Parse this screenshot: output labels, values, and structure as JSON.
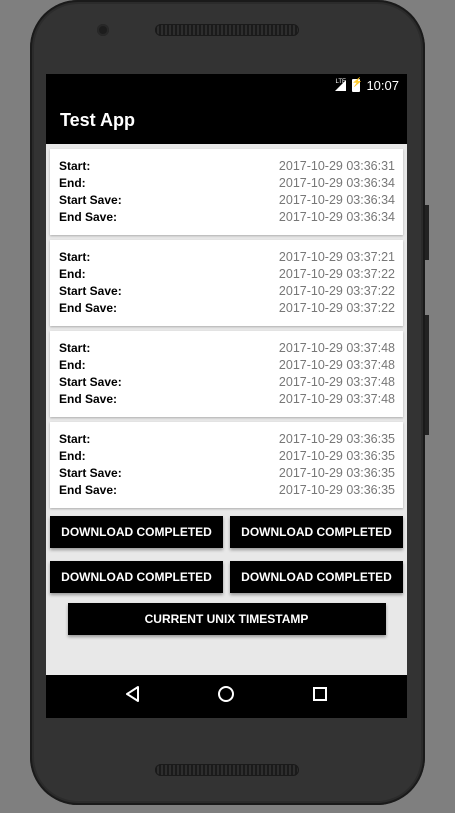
{
  "status_bar": {
    "network_label": "LTE",
    "time": "10:07"
  },
  "app": {
    "title": "Test App"
  },
  "cards": [
    {
      "rows": [
        {
          "label": "Start:",
          "value": "2017-10-29 03:36:31"
        },
        {
          "label": "End:",
          "value": "2017-10-29 03:36:34"
        },
        {
          "label": "Start Save:",
          "value": "2017-10-29 03:36:34"
        },
        {
          "label": "End Save:",
          "value": "2017-10-29 03:36:34"
        }
      ]
    },
    {
      "rows": [
        {
          "label": "Start:",
          "value": "2017-10-29 03:37:21"
        },
        {
          "label": "End:",
          "value": "2017-10-29 03:37:22"
        },
        {
          "label": "Start Save:",
          "value": "2017-10-29 03:37:22"
        },
        {
          "label": "End Save:",
          "value": "2017-10-29 03:37:22"
        }
      ]
    },
    {
      "rows": [
        {
          "label": "Start:",
          "value": "2017-10-29 03:37:48"
        },
        {
          "label": "End:",
          "value": "2017-10-29 03:37:48"
        },
        {
          "label": "Start Save:",
          "value": "2017-10-29 03:37:48"
        },
        {
          "label": "End Save:",
          "value": "2017-10-29 03:37:48"
        }
      ]
    },
    {
      "rows": [
        {
          "label": "Start:",
          "value": "2017-10-29 03:36:35"
        },
        {
          "label": "End:",
          "value": "2017-10-29 03:36:35"
        },
        {
          "label": "Start Save:",
          "value": "2017-10-29 03:36:35"
        },
        {
          "label": "End Save:",
          "value": "2017-10-29 03:36:35"
        }
      ]
    }
  ],
  "buttons": {
    "download": [
      "DOWNLOAD COMPLETED",
      "DOWNLOAD COMPLETED",
      "DOWNLOAD COMPLETED",
      "DOWNLOAD COMPLETED"
    ],
    "timestamp": "CURRENT UNIX TIMESTAMP"
  },
  "nav_icons": [
    "back-icon",
    "home-icon",
    "recents-icon"
  ],
  "colors": {
    "toolbar": "#000000",
    "button": "#000000",
    "value_text": "#777777",
    "background": "#e8e8e8"
  }
}
